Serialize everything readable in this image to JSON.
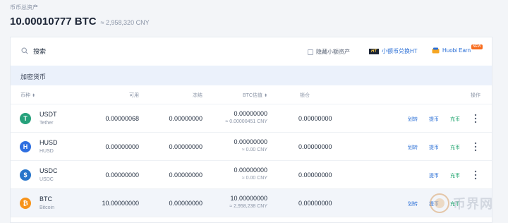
{
  "header": {
    "label": "币币总资产",
    "total_btc": "10.00010777 BTC",
    "total_cny": "≈ 2,958,320 CNY"
  },
  "toolbar": {
    "search_placeholder": "搜索",
    "hide_small_label": "隐藏小额资产",
    "ht_icon_text": "HT",
    "ht_link_label": "小额币兑换HT",
    "earn_label": "Huobi Earn",
    "earn_badge": "NEW"
  },
  "section": {
    "title": "加密货币"
  },
  "columns": {
    "coin": "币种",
    "available": "可用",
    "frozen": "冻结",
    "btc_value": "BTC估值",
    "locked": "锁仓",
    "actions": "操作",
    "sort_glyph": "⬍"
  },
  "actions": {
    "transfer": "划转",
    "withdraw": "提币",
    "deposit": "充币"
  },
  "rows": [
    {
      "symbol": "USDT",
      "name": "Tether",
      "logo_char": "T",
      "logo_color": "#26a17b",
      "available": "0.00000068",
      "frozen": "0.00000000",
      "btc": "0.00000000",
      "btc_cny": "≈ 0.00000451 CNY",
      "locked": "0.00000000",
      "has_transfer": true
    },
    {
      "symbol": "HUSD",
      "name": "HUSD",
      "logo_char": "H",
      "logo_color": "#2f6fe0",
      "available": "0.00000000",
      "frozen": "0.00000000",
      "btc": "0.00000000",
      "btc_cny": "≈ 0.00 CNY",
      "locked": "0.00000000",
      "has_transfer": true
    },
    {
      "symbol": "USDC",
      "name": "USDC",
      "logo_char": "$",
      "logo_color": "#2775ca",
      "available": "0.00000000",
      "frozen": "0.00000000",
      "btc": "0.00000000",
      "btc_cny": "≈ 0.00 CNY",
      "locked": "0.00000000",
      "has_transfer": false
    },
    {
      "symbol": "BTC",
      "name": "Bitcoin",
      "logo_char": "₿",
      "logo_color": "#f7931a",
      "available": "10.00000000",
      "frozen": "0.00000000",
      "btc": "10.00000000",
      "btc_cny": "≈ 2,958,238 CNY",
      "locked": "0.00000000",
      "has_transfer": true
    }
  ],
  "watermark": {
    "text": "币界网"
  }
}
